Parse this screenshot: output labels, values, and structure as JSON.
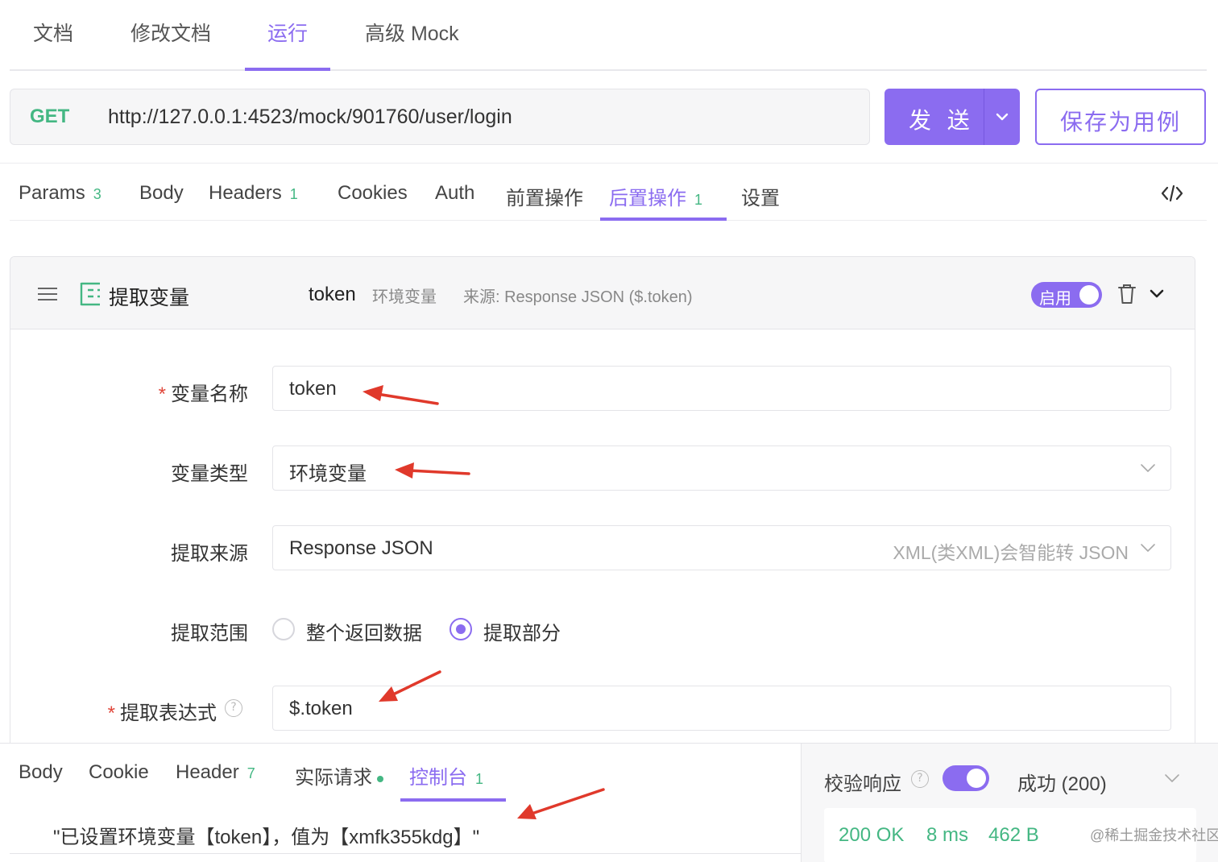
{
  "top_tabs": [
    "文档",
    "修改文档",
    "运行",
    "高级 Mock"
  ],
  "request": {
    "method": "GET",
    "url": "http://127.0.0.1:4523/mock/901760/user/login",
    "send_label": "发 送",
    "save_label": "保存为用例"
  },
  "request_tabs": {
    "params": "Params",
    "params_count": "3",
    "body": "Body",
    "headers": "Headers",
    "headers_count": "1",
    "cookies": "Cookies",
    "auth": "Auth",
    "pre_ops": "前置操作",
    "post_ops": "后置操作",
    "post_ops_count": "1",
    "settings": "设置"
  },
  "extract": {
    "title": "提取变量",
    "header_var_name": "token",
    "header_var_type": "环境变量",
    "header_source": "来源: Response JSON ($.token)",
    "enabled_label": "启用",
    "fields": {
      "var_name_label": "变量名称",
      "var_name_value": "token",
      "var_type_label": "变量类型",
      "var_type_value": "环境变量",
      "source_label": "提取来源",
      "source_value": "Response JSON",
      "source_hint": "XML(类XML)会智能转 JSON",
      "scope_label": "提取范围",
      "scope_option_all": "整个返回数据",
      "scope_option_part": "提取部分",
      "expr_label": "提取表达式",
      "expr_value": "$.token"
    },
    "required_mark": "*",
    "help_mark": "?"
  },
  "response_tabs": {
    "body": "Body",
    "cookie": "Cookie",
    "header": "Header",
    "header_count": "7",
    "actual_request": "实际请求",
    "console": "控制台",
    "console_count": "1"
  },
  "console_output": "\"已设置环境变量【token】，值为【xmfk355kdg】\"",
  "validation": {
    "label": "校验响应",
    "result": "成功 (200)",
    "status": "200 OK",
    "time": "8 ms",
    "size": "462 B"
  },
  "watermark": "@稀土掘金技术社区",
  "colors": {
    "accent": "#8b6cf0",
    "success": "#44b783",
    "required": "#e0463a",
    "annotation_arrow": "#e0392b"
  }
}
